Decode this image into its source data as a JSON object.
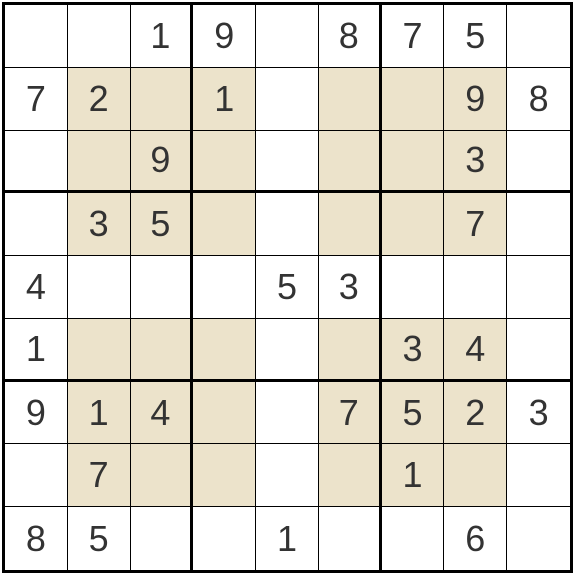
{
  "sudoku": {
    "size": 9,
    "shaded_pattern": "inner-diamond",
    "grid": [
      [
        "",
        "",
        "1",
        "9",
        "",
        "8",
        "7",
        "5",
        ""
      ],
      [
        "7",
        "2",
        "",
        "1",
        "",
        "",
        "",
        "9",
        "8"
      ],
      [
        "",
        "",
        "9",
        "",
        "",
        "",
        "",
        "3",
        ""
      ],
      [
        "",
        "3",
        "5",
        "",
        "",
        "",
        "",
        "7",
        ""
      ],
      [
        "4",
        "",
        "",
        "",
        "5",
        "3",
        "",
        "",
        ""
      ],
      [
        "1",
        "",
        "",
        "",
        "",
        "",
        "3",
        "4",
        ""
      ],
      [
        "9",
        "1",
        "4",
        "",
        "",
        "7",
        "5",
        "2",
        "3"
      ],
      [
        "",
        "7",
        "",
        "",
        "",
        "",
        "1",
        "",
        ""
      ],
      [
        "8",
        "5",
        "",
        "",
        "1",
        "",
        "",
        "6",
        ""
      ]
    ],
    "shaded": [
      [
        0,
        0,
        0,
        0,
        0,
        0,
        0,
        0,
        0
      ],
      [
        0,
        1,
        1,
        1,
        0,
        1,
        1,
        1,
        0
      ],
      [
        0,
        1,
        1,
        1,
        0,
        1,
        1,
        1,
        0
      ],
      [
        0,
        1,
        1,
        1,
        0,
        1,
        1,
        1,
        0
      ],
      [
        0,
        0,
        0,
        0,
        0,
        0,
        0,
        0,
        0
      ],
      [
        0,
        1,
        1,
        1,
        0,
        1,
        1,
        1,
        0
      ],
      [
        0,
        1,
        1,
        1,
        0,
        1,
        1,
        1,
        0
      ],
      [
        0,
        1,
        1,
        1,
        0,
        1,
        1,
        1,
        0
      ],
      [
        0,
        0,
        0,
        0,
        0,
        0,
        0,
        0,
        0
      ]
    ]
  }
}
